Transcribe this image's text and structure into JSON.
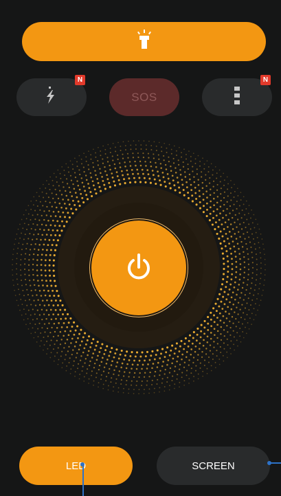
{
  "flashlight_toggle": {
    "icon": "flashlight-icon",
    "color": "#F39712"
  },
  "quick_actions": {
    "strobe": {
      "icon": "lightning-icon",
      "badge": "N"
    },
    "sos": {
      "label": "SOS",
      "color": "#5C2A2A"
    },
    "more": {
      "icon": "more-vertical-icon",
      "badge": "N"
    }
  },
  "power": {
    "icon": "power-icon",
    "color": "#F39712",
    "dot_color": "#F2B233"
  },
  "modes": {
    "led_label": "LED",
    "screen_label": "SCREEN",
    "active": "LED"
  },
  "colors": {
    "background": "#151616",
    "chip": "#292B2C",
    "accent": "#F39712",
    "badge": "#E23A2B",
    "marker": "#2D72C8"
  }
}
